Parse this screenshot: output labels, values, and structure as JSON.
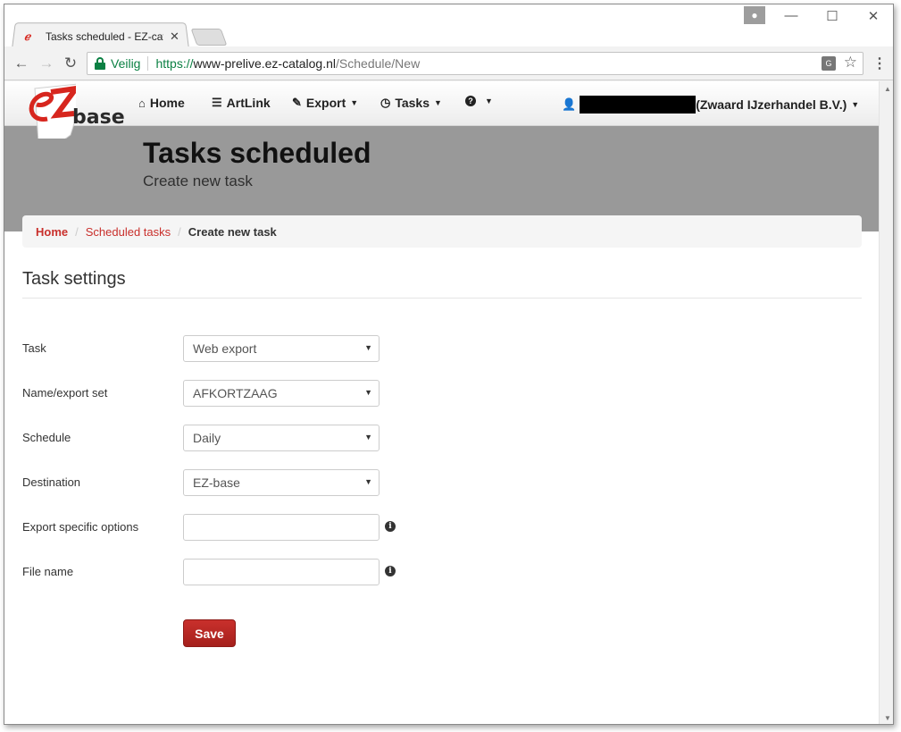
{
  "browser": {
    "tab_title": "Tasks scheduled - EZ-catalog",
    "tab_close": "✕",
    "secure_label": "Veilig",
    "url_scheme": "https://",
    "url_host": "www-prelive.ez-catalog.nl",
    "url_path": "/Schedule/New"
  },
  "navbar": {
    "logo_text": "base",
    "items": [
      {
        "label": "Home",
        "icon": "home-icon"
      },
      {
        "label": "ArtLink",
        "icon": "list-icon"
      },
      {
        "label": "Export",
        "icon": "pencil-icon"
      },
      {
        "label": "Tasks",
        "icon": "clock-icon"
      },
      {
        "label": "",
        "icon": "question-icon"
      }
    ],
    "user_suffix": "(Zwaard IJzerhandel B.V.)"
  },
  "banner": {
    "title": "Tasks scheduled",
    "subtitle": "Create new task"
  },
  "breadcrumb": {
    "home": "Home",
    "scheduled": "Scheduled tasks",
    "current": "Create new task"
  },
  "form": {
    "section_title": "Task settings",
    "task_label": "Task",
    "task_value": "Web export",
    "name_label": "Name/export set",
    "name_value": "AFKORTZAAG",
    "schedule_label": "Schedule",
    "schedule_value": "Daily",
    "destination_label": "Destination",
    "destination_value": "EZ-base",
    "options_label": "Export specific options",
    "options_value": "",
    "filename_label": "File name",
    "filename_value": "",
    "save_label": "Save"
  },
  "colors": {
    "accent": "#c9302c",
    "banner": "#999999",
    "secure": "#0b8043"
  }
}
